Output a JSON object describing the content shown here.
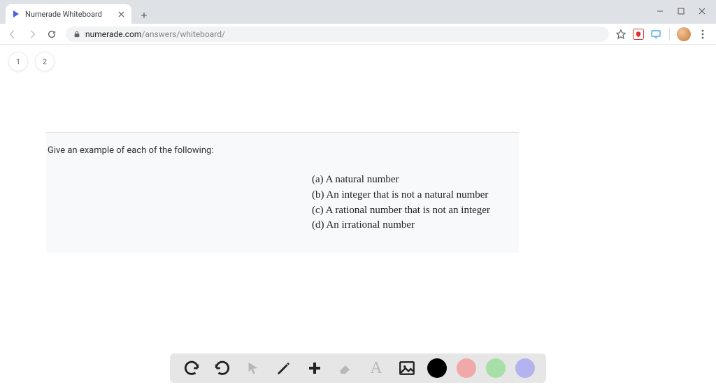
{
  "window": {
    "tab_title": "Numerade Whiteboard",
    "url_domain": "numerade.com",
    "url_path": "/answers/whiteboard/"
  },
  "page": {
    "tabs": [
      "1",
      "2"
    ],
    "question_prompt": "Give an example of each of the following:",
    "items": [
      "(a) A natural number",
      "(b) An integer that is not a natural number",
      "(c) A rational number that is not an integer",
      "(d) An irrational number"
    ]
  },
  "toolbar": {
    "tools": [
      "undo",
      "redo",
      "pointer",
      "pen",
      "add",
      "eraser",
      "text",
      "image"
    ],
    "colors": [
      "#000000",
      "#f0a9a9",
      "#a7e0a7",
      "#b3b3f0"
    ]
  }
}
